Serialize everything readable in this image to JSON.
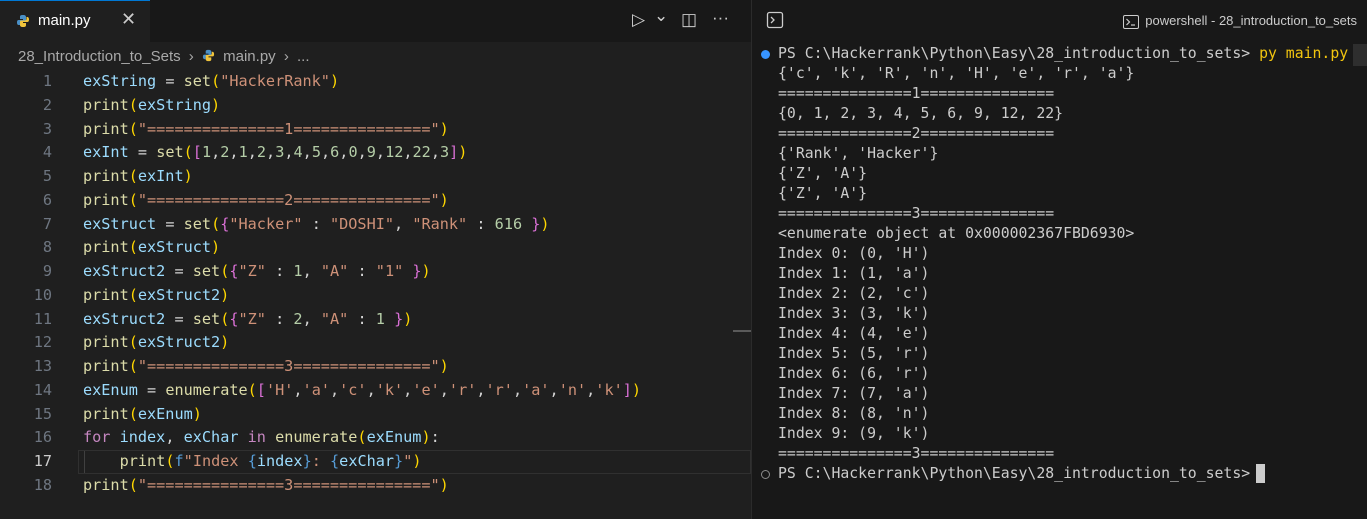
{
  "editor": {
    "tab": {
      "label": "main.py",
      "close": "✕"
    },
    "toolbar": {
      "run_icon": "▷",
      "dropdown_icon": "⌄",
      "split_icon": "◫",
      "more_icon": "···"
    },
    "breadcrumb": {
      "folder": "28_Introduction_to_Sets",
      "file": "main.py",
      "more": "..."
    },
    "current_line": 17,
    "lines": [
      "exString = set(\"HackerRank\")",
      "print(exString)",
      "print(\"===============1===============\")",
      "exInt = set([1,2,1,2,3,4,5,6,0,9,12,22,3])",
      "print(exInt)",
      "print(\"===============2===============\")",
      "exStruct = set({\"Hacker\" : \"DOSHI\", \"Rank\" : 616 })",
      "print(exStruct)",
      "exStruct2 = set({\"Z\" : 1, \"A\" : \"1\" })",
      "print(exStruct2)",
      "exStruct2 = set({\"Z\" : 2, \"A\" : 1 })",
      "print(exStruct2)",
      "print(\"===============3===============\")",
      "exEnum = enumerate(['H','a','c','k','e','r','r','a','n','k'])",
      "print(exEnum)",
      "for index, exChar in enumerate(exEnum):",
      "    print(f\"Index {index}: {exChar}\")",
      "print(\"===============3===============\")"
    ]
  },
  "terminal": {
    "title": "powershell - 28_introduction_to_sets",
    "prompt": "PS C:\\Hackerrank\\Python\\Easy\\28_introduction_to_sets>",
    "command": "py main.py",
    "output": [
      "{'c', 'k', 'R', 'n', 'H', 'e', 'r', 'a'}",
      "===============1===============",
      "{0, 1, 2, 3, 4, 5, 6, 9, 12, 22}",
      "===============2===============",
      "{'Rank', 'Hacker'}",
      "{'Z', 'A'}",
      "{'Z', 'A'}",
      "===============3===============",
      "<enumerate object at 0x000002367FBD6930>",
      "Index 0: (0, 'H')",
      "Index 1: (1, 'a')",
      "Index 2: (2, 'c')",
      "Index 3: (3, 'k')",
      "Index 4: (4, 'e')",
      "Index 5: (5, 'r')",
      "Index 6: (6, 'r')",
      "Index 7: (7, 'a')",
      "Index 8: (8, 'n')",
      "Index 9: (9, 'k')",
      "===============3==============="
    ]
  }
}
